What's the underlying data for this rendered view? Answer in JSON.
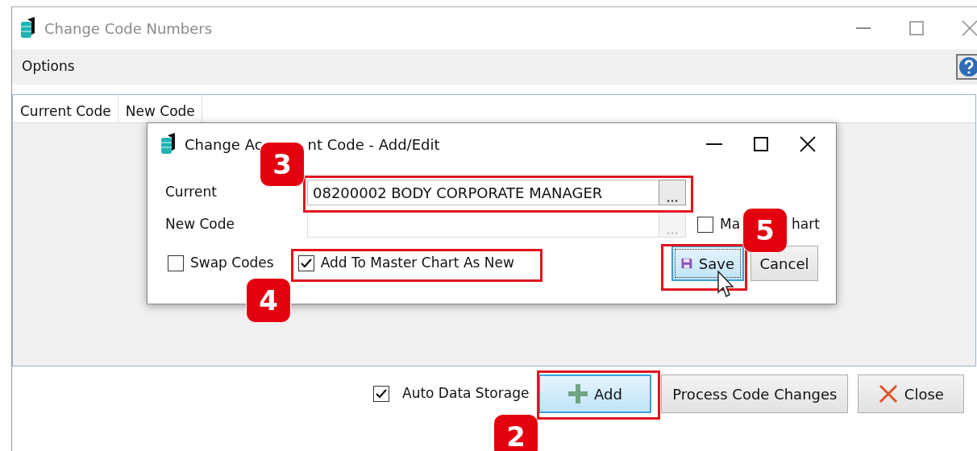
{
  "window": {
    "title": "Change Code Numbers"
  },
  "menu": [
    {
      "label": "Options"
    }
  ],
  "table": {
    "columns": [
      "Current Code",
      "New Code"
    ]
  },
  "auto_data_storage": {
    "label": "Auto Data Storage",
    "checked": true
  },
  "buttons": [
    {
      "label": "Add",
      "kind": "add",
      "focused": true
    },
    {
      "label": "Process Code Changes",
      "kind": "plain",
      "focused": false
    },
    {
      "label": "Close",
      "kind": "close",
      "focused": false
    }
  ],
  "dialog": {
    "title_parts": [
      "Change Ac",
      "nt Code - Add/Edit"
    ],
    "fields": [
      {
        "label": "Current",
        "value": "08200002 BODY CORPORATE MANAGER",
        "disabled": false
      },
      {
        "label": "New Code",
        "disabled": true
      }
    ],
    "master_chart": {
      "label_parts": [
        "Ma",
        "hart"
      ],
      "checked": false
    },
    "checkboxes": [
      {
        "label": "Swap Codes",
        "checked": false
      },
      {
        "label": "Add To Master Chart As New",
        "checked": true
      }
    ],
    "buttons": [
      {
        "label": "Save",
        "kind": "save",
        "focused": true
      },
      {
        "label": "Cancel",
        "kind": "plain",
        "focused": false
      }
    ]
  },
  "callouts": [
    {
      "number": "2"
    },
    {
      "number": "3"
    },
    {
      "number": "4"
    },
    {
      "number": "5"
    }
  ]
}
